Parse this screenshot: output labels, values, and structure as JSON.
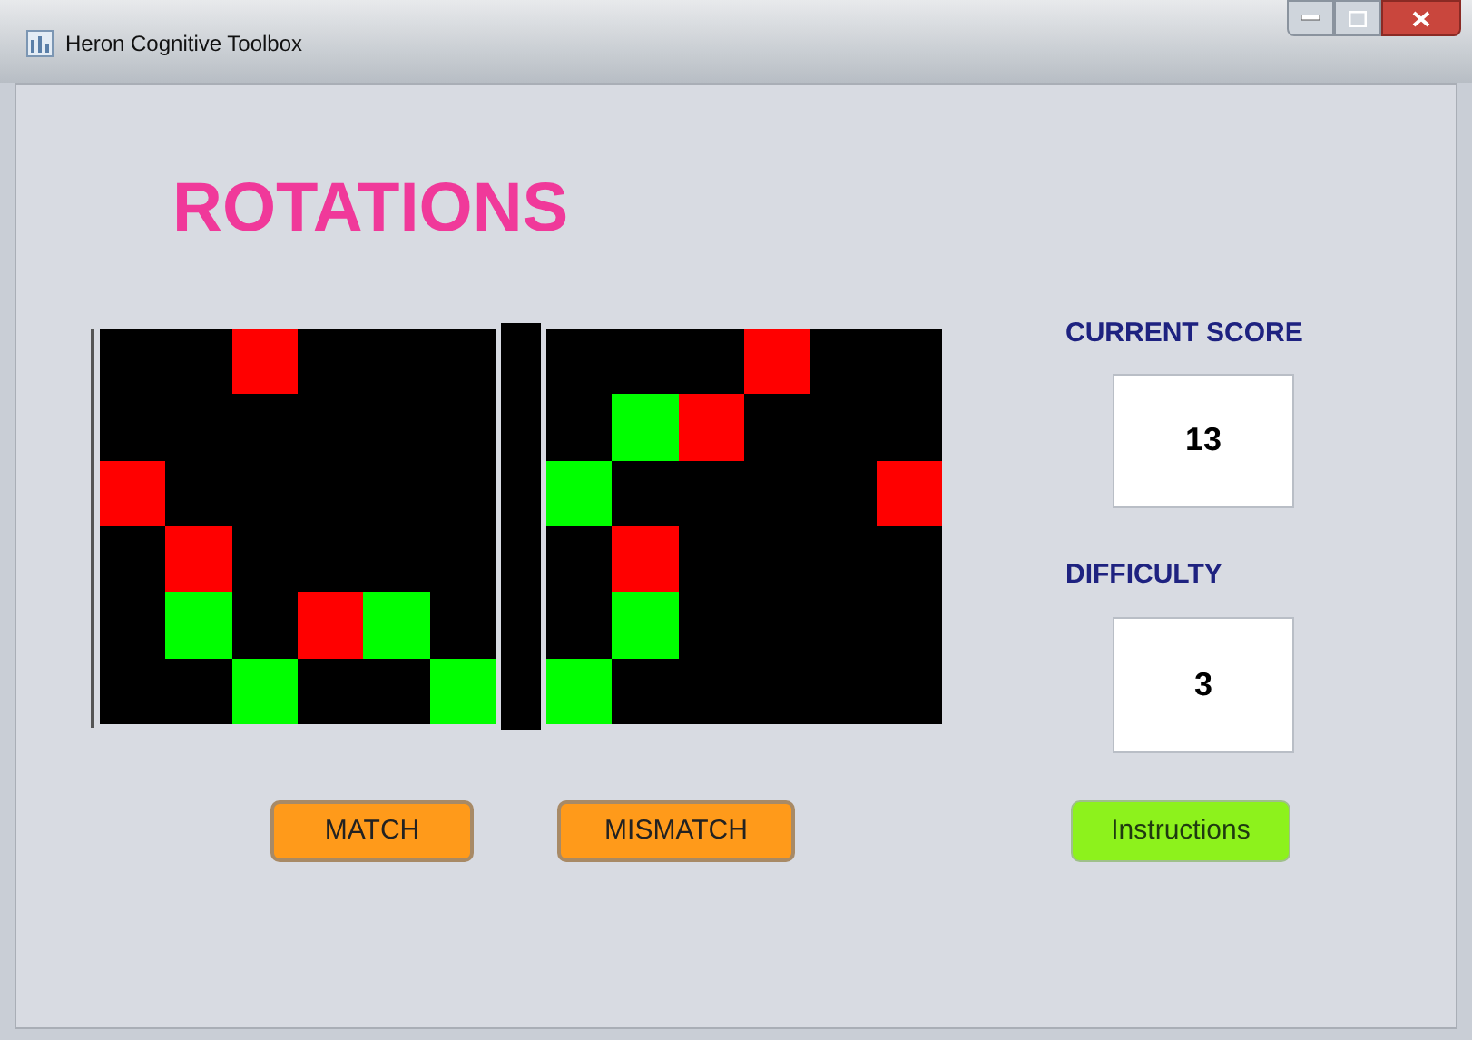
{
  "window": {
    "title": "Heron Cognitive Toolbox"
  },
  "heading": "ROTATIONS",
  "grids": [
    {
      "rows": [
        [
          {
            "kind": "off"
          },
          {
            "kind": "off"
          },
          {
            "kind": "red"
          },
          {
            "kind": "off"
          },
          {
            "kind": "off"
          },
          {
            "kind": "off"
          }
        ],
        [
          {
            "kind": "off"
          },
          {
            "kind": "off"
          },
          {
            "kind": "off"
          },
          {
            "kind": "off"
          },
          {
            "kind": "off"
          },
          {
            "kind": "off"
          }
        ],
        [
          {
            "kind": "red"
          },
          {
            "kind": "off"
          },
          {
            "kind": "off"
          },
          {
            "kind": "off"
          },
          {
            "kind": "off"
          },
          {
            "kind": "off"
          }
        ],
        [
          {
            "kind": "off"
          },
          {
            "kind": "red"
          },
          {
            "kind": "off"
          },
          {
            "kind": "off"
          },
          {
            "kind": "off"
          },
          {
            "kind": "off"
          }
        ],
        [
          {
            "kind": "off"
          },
          {
            "kind": "green"
          },
          {
            "kind": "off"
          },
          {
            "kind": "red"
          },
          {
            "kind": "green"
          },
          {
            "kind": "off"
          }
        ],
        [
          {
            "kind": "off"
          },
          {
            "kind": "off"
          },
          {
            "kind": "green"
          },
          {
            "kind": "off"
          },
          {
            "kind": "off"
          },
          {
            "kind": "green"
          }
        ]
      ]
    },
    {
      "rows": [
        [
          {
            "kind": "off"
          },
          {
            "kind": "off"
          },
          {
            "kind": "off"
          },
          {
            "kind": "red"
          },
          {
            "kind": "off"
          },
          {
            "kind": "off"
          }
        ],
        [
          {
            "kind": "off"
          },
          {
            "kind": "green"
          },
          {
            "kind": "red"
          },
          {
            "kind": "off"
          },
          {
            "kind": "off"
          },
          {
            "kind": "off"
          }
        ],
        [
          {
            "kind": "green"
          },
          {
            "kind": "off"
          },
          {
            "kind": "off"
          },
          {
            "kind": "off"
          },
          {
            "kind": "off"
          },
          {
            "kind": "red"
          }
        ],
        [
          {
            "kind": "off"
          },
          {
            "kind": "red"
          },
          {
            "kind": "off"
          },
          {
            "kind": "off"
          },
          {
            "kind": "off"
          },
          {
            "kind": "off"
          }
        ],
        [
          {
            "kind": "off"
          },
          {
            "kind": "green"
          },
          {
            "kind": "off"
          },
          {
            "kind": "off"
          },
          {
            "kind": "off"
          },
          {
            "kind": "off"
          }
        ],
        [
          {
            "kind": "green"
          },
          {
            "kind": "off"
          },
          {
            "kind": "off"
          },
          {
            "kind": "off"
          },
          {
            "kind": "off"
          },
          {
            "kind": "off"
          }
        ]
      ]
    }
  ],
  "score": {
    "label": "CURRENT SCORE",
    "value": "13"
  },
  "difficulty": {
    "label": "DIFFICULTY",
    "value": "3"
  },
  "buttons": [
    {
      "label": "MATCH",
      "kind": "answer"
    },
    {
      "label": "MISMATCH",
      "kind": "answer"
    },
    {
      "label": "Instructions",
      "kind": "help"
    }
  ]
}
